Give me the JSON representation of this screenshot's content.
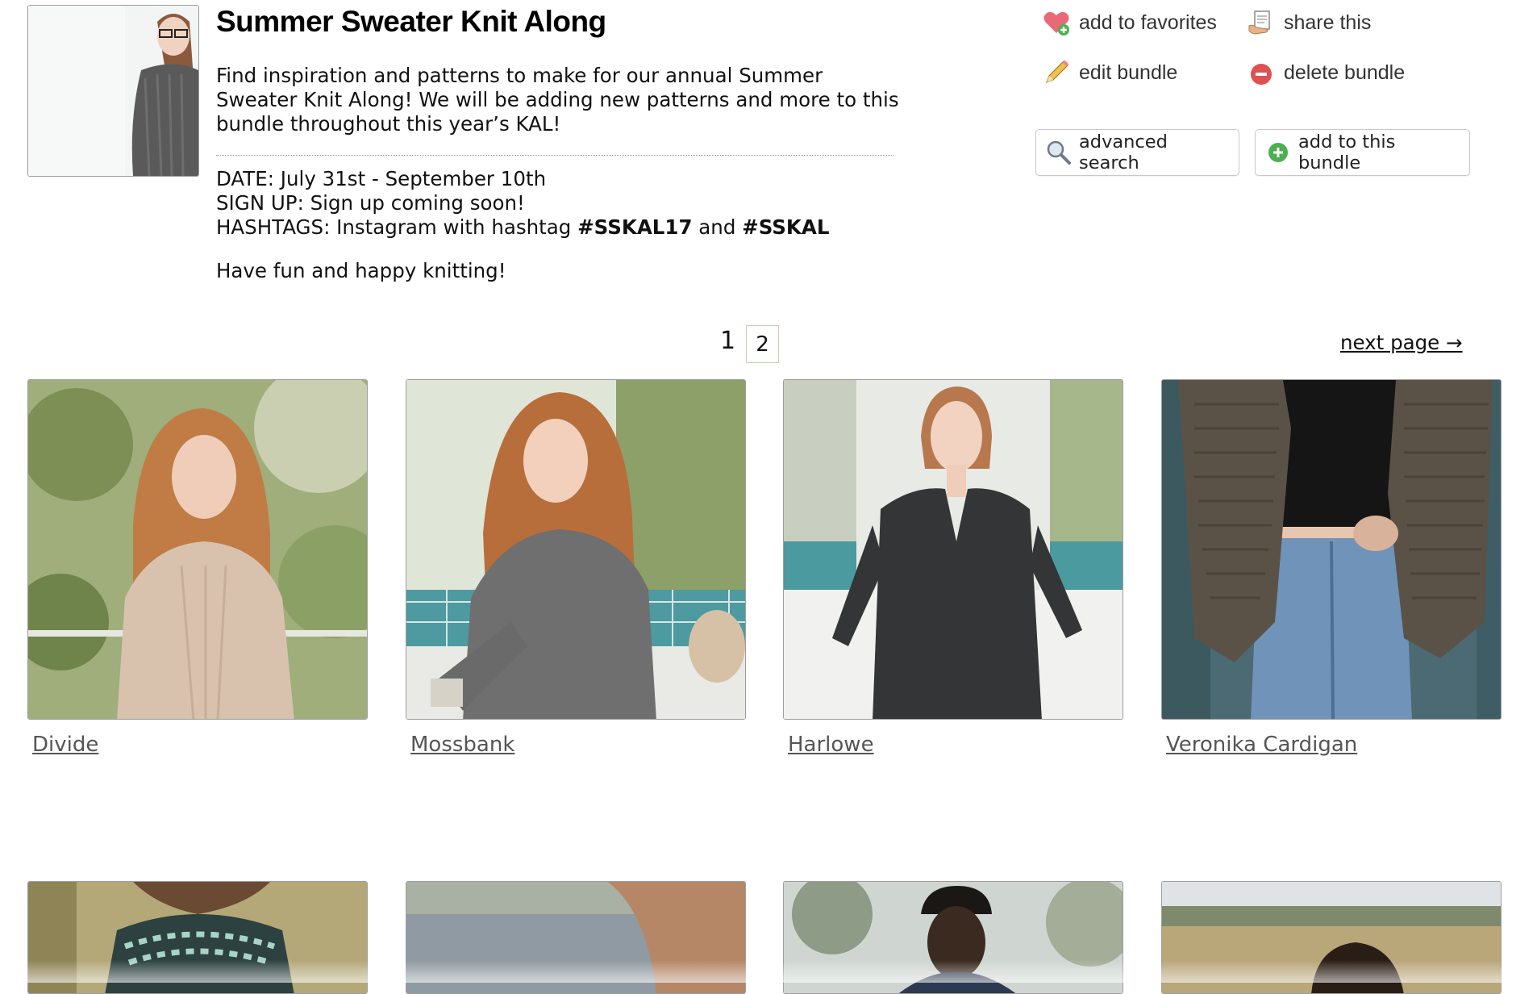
{
  "bundle": {
    "title": "Summer Sweater Knit Along",
    "description": "Find inspiration and patterns to make for our annual Summer Sweater Knit Along! We will be adding new patterns and more to this bundle throughout this year’s KAL!",
    "date_line": "DATE: July 31st - September 10th",
    "signup_line": "SIGN UP: Sign up coming soon!",
    "hashtags_prefix": "HASHTAGS: Instagram with hashtag ",
    "hashtag1": "#SSKAL17",
    "hashtags_and": " and ",
    "hashtag2": "#SSKAL",
    "closing": "Have fun and happy knitting!"
  },
  "actions": {
    "favorites": "add to favorites",
    "share": "share this",
    "edit": "edit bundle",
    "delete": "delete bundle",
    "advanced_search": "advanced search",
    "add_to_bundle": "add to this bundle"
  },
  "pagination": {
    "current": "1",
    "next_num": "2",
    "next_label": "next page →"
  },
  "patterns": [
    {
      "name": "Divide"
    },
    {
      "name": "Mossbank"
    },
    {
      "name": "Harlowe"
    },
    {
      "name": "Veronika Cardigan"
    }
  ],
  "colors": {
    "link": "#555555",
    "pager_border": "#b9dca9",
    "favorite_icon": "#e86a77",
    "add_icon": "#4caf50",
    "delete_icon": "#e05050"
  }
}
